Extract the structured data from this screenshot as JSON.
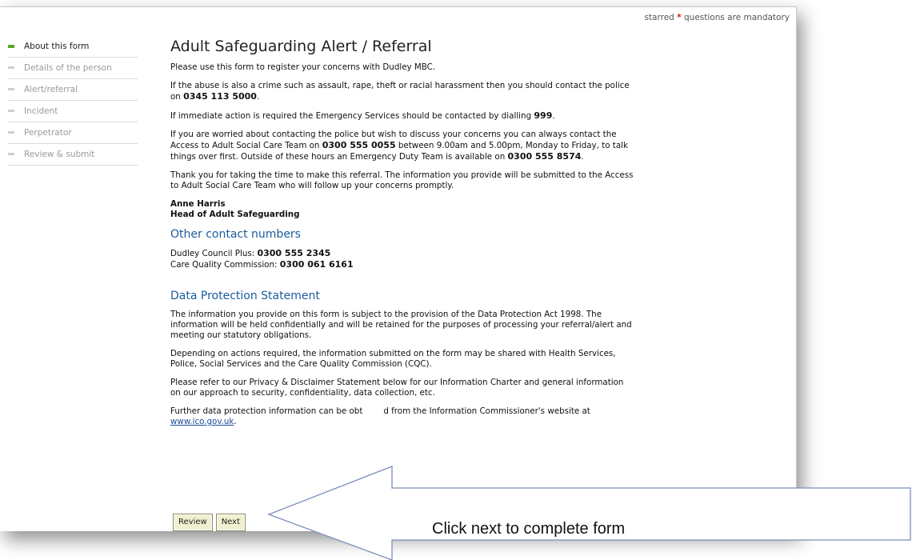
{
  "header": {
    "mandatory_prefix": "starred",
    "mandatory_star": "*",
    "mandatory_suffix": "questions are mandatory"
  },
  "sidebar": {
    "items": [
      {
        "label": "About this form",
        "active": true
      },
      {
        "label": "Details of the person",
        "active": false
      },
      {
        "label": "Alert/referral",
        "active": false
      },
      {
        "label": "Incident",
        "active": false
      },
      {
        "label": "Perpetrator",
        "active": false
      },
      {
        "label": "Review & submit",
        "active": false
      }
    ]
  },
  "main": {
    "title": "Adult Safeguarding Alert / Referral",
    "intro": "Please use this form to register your concerns with Dudley MBC.",
    "crime_text": "If the abuse is also a crime such as assault, rape, theft or racial harassment then you should contact the police on",
    "police_number": "0345 113 5000",
    "period": ".",
    "emergency_text": "If immediate action is required the Emergency Services should be contacted by dialling",
    "emergency_number": "999",
    "worried_text_1": "If you are worried about contacting the police but wish to discuss your concerns you can always contact the Access to Adult Social Care Team on",
    "access_number": "0300 555 0055",
    "worried_text_2": "between 9.00am and 5.00pm, Monday to Friday, to talk things over first.  Outside of these hours an Emergency Duty Team is available on",
    "duty_number": "0300 555 8574",
    "thanks_text": "Thank you for taking the time to make this referral. The information you provide will be submitted to the Access to Adult Social Care Team who will follow up your concerns promptly.",
    "signature_name": "Anne Harris",
    "signature_title": "Head of Adult Safeguarding",
    "contacts_heading": "Other contact numbers",
    "contact_1_label": "Dudley Council Plus:",
    "contact_1_number": "0300 555 2345",
    "contact_2_label": "Care Quality Commission:",
    "contact_2_number": "0300 061 6161",
    "dp_heading": "Data Protection Statement",
    "dp_para_1": "The information you provide on this form is subject to the provision of the Data Protection Act 1998. The information will be held confidentially and will be retained for the purposes of processing your referral/alert and meeting our statutory obligations.",
    "dp_para_2": "Depending on actions required, the information submitted on the form may be shared with Health Services, Police, Social Services and the Care Quality Commission (CQC).",
    "dp_para_3": "Please refer to our Privacy & Disclaimer Statement below for our Information Charter and general information on our approach to security, confidentiality, data collection, etc.",
    "dp_para_4_a": "Further data protection information can be obt",
    "dp_para_4_b": "d from the Information Commissioner's website at",
    "ico_link": "www.ico.gov.uk",
    "ico_suffix": "."
  },
  "buttons": {
    "review_label": "Review",
    "next_label": "Next"
  },
  "callout": {
    "text": "Click next to complete form"
  },
  "colors": {
    "active_marker": "#58a820",
    "heading_blue": "#1a5c9c",
    "star_red": "#e01010"
  }
}
